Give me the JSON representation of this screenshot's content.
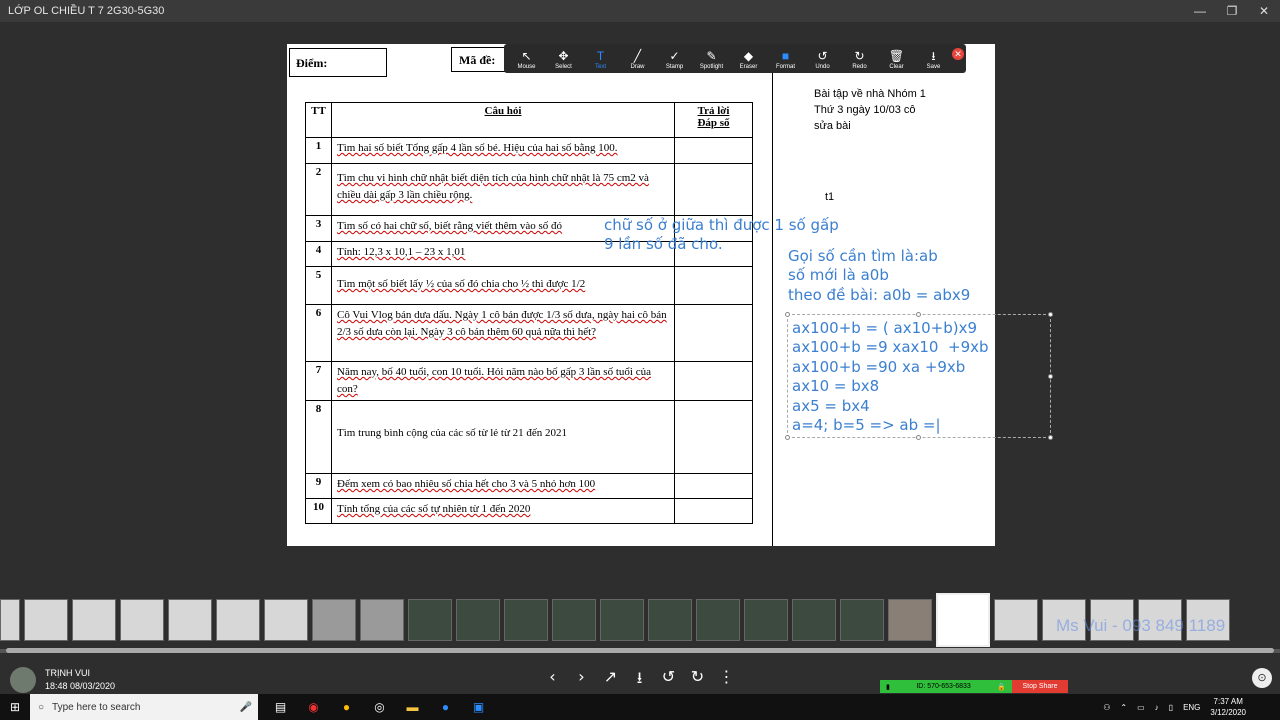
{
  "window": {
    "title": "LỚP OL CHIỀU T 7 2G30-5G30"
  },
  "window_controls": {
    "minimize": "—",
    "restore": "❐",
    "close": "✕"
  },
  "document": {
    "score_label": "Điểm:",
    "code_label": "Mã đề:",
    "table": {
      "headers": {
        "num": "TT",
        "question": "Câu hỏi",
        "answer_line1": "Trả lời",
        "answer_line2": "Đáp số"
      },
      "rows": [
        {
          "num": "1",
          "text": "Tìm hai số biết Tổng gấp 4 lần số bé. Hiệu của hai số bằng 100."
        },
        {
          "num": "2",
          "text": "Tìm chu vi hình chữ nhật biết diện tích của hình chữ nhật là 75 cm2 và chiều dài gấp 3 lần chiều rộng."
        },
        {
          "num": "3",
          "text": "Tìm số có hai chữ số, biết rằng viết thêm vào số đó"
        },
        {
          "num": "4",
          "text": "Tính: 12,3 x 10,1 – 23 x 1,01"
        },
        {
          "num": "5",
          "text": "Tìm một số biết lấy ½ của số đó chia cho ½ thì được 1/2"
        },
        {
          "num": "6",
          "text": "Cô Vui Vlog bán dưa dấu. Ngày 1 cô bán được 1/3 số dưa, ngày hai cô bán 2/3 số dưa còn lại. Ngày 3 cô bán thêm 60 quả nữa thì hết?"
        },
        {
          "num": "7",
          "text": "Năm nay, bố 40 tuổi, con 10 tuổi. Hỏi năm nào bố gấp 3 lần số tuổi của con?"
        },
        {
          "num": "8",
          "text": "Tìm trung bình cộng của các số từ lẻ từ 21 đến 2021"
        },
        {
          "num": "9",
          "text": "Đếm xem có bao nhiêu số chia hết cho 3 và 5 nhỏ hơn 100"
        },
        {
          "num": "10",
          "text": "Tính tổng của các số tự nhiên từ 1 đến 2020"
        }
      ]
    },
    "homework_note": [
      "Bài tập về nhà Nhóm 1",
      "Thứ 3 ngày 10/03 cô",
      "sửa bài"
    ],
    "t1_label": "t1"
  },
  "annotation_toolbar": {
    "tools": [
      {
        "name": "mouse",
        "label": "Mouse",
        "icon": "cursor-icon",
        "glyph": "↖"
      },
      {
        "name": "select",
        "label": "Select",
        "icon": "move-icon",
        "glyph": "✥"
      },
      {
        "name": "text",
        "label": "Text",
        "icon": "text-icon",
        "glyph": "T",
        "active": true
      },
      {
        "name": "draw",
        "label": "Draw",
        "icon": "pen-icon",
        "glyph": "╱"
      },
      {
        "name": "stamp",
        "label": "Stamp",
        "icon": "check-icon",
        "glyph": "✓"
      },
      {
        "name": "spotlight",
        "label": "Spotlight",
        "icon": "spotlight-icon",
        "glyph": "✎"
      },
      {
        "name": "eraser",
        "label": "Eraser",
        "icon": "eraser-icon",
        "glyph": "◆"
      },
      {
        "name": "format",
        "label": "Format",
        "icon": "format-icon",
        "glyph": "■"
      },
      {
        "name": "undo",
        "label": "Undo",
        "icon": "undo-icon",
        "glyph": "↺"
      },
      {
        "name": "redo",
        "label": "Redo",
        "icon": "redo-icon",
        "glyph": "↻"
      },
      {
        "name": "clear",
        "label": "Clear",
        "icon": "trash-icon",
        "glyph": "🗑"
      },
      {
        "name": "save",
        "label": "Save",
        "icon": "save-icon",
        "glyph": "⭳"
      }
    ],
    "close_glyph": "✕",
    "accent_color": "#2d8cff"
  },
  "annotations": {
    "line_q3_a": "chữ số ở giữa thì được 1 số gấp",
    "line_q3_b": "9 lần số đã cho.",
    "intro": [
      "Gọi số cần tìm là:ab",
      "số mới là a0b",
      "theo đề bài: a0b = abx9"
    ],
    "work": [
      "ax100+b = ( ax10+b)x9",
      "ax100+b =9 xax10  +9xb",
      "ax100+b =90 xa +9xb",
      "ax10 = bx8",
      "ax5 = bx4",
      "a=4; b=5 => ab =|"
    ],
    "color": "#3b7fd0"
  },
  "thumbnail_strip": {
    "watermark": "Ms Vui - 093 849 1189"
  },
  "presenter": {
    "name": "TRỊNH VUI",
    "timestamp": "18:48 08/03/2020"
  },
  "nav_controls": [
    "‹",
    "›",
    "↗",
    "⭳",
    "↺",
    "↻",
    "⋮"
  ],
  "meeting": {
    "id_label": "ID: 570-653-6833",
    "stop_share": "Stop Share"
  },
  "taskbar": {
    "search_placeholder": "Type here to search",
    "lang": "ENG",
    "time": "7:37 AM",
    "date": "3/12/2020"
  }
}
